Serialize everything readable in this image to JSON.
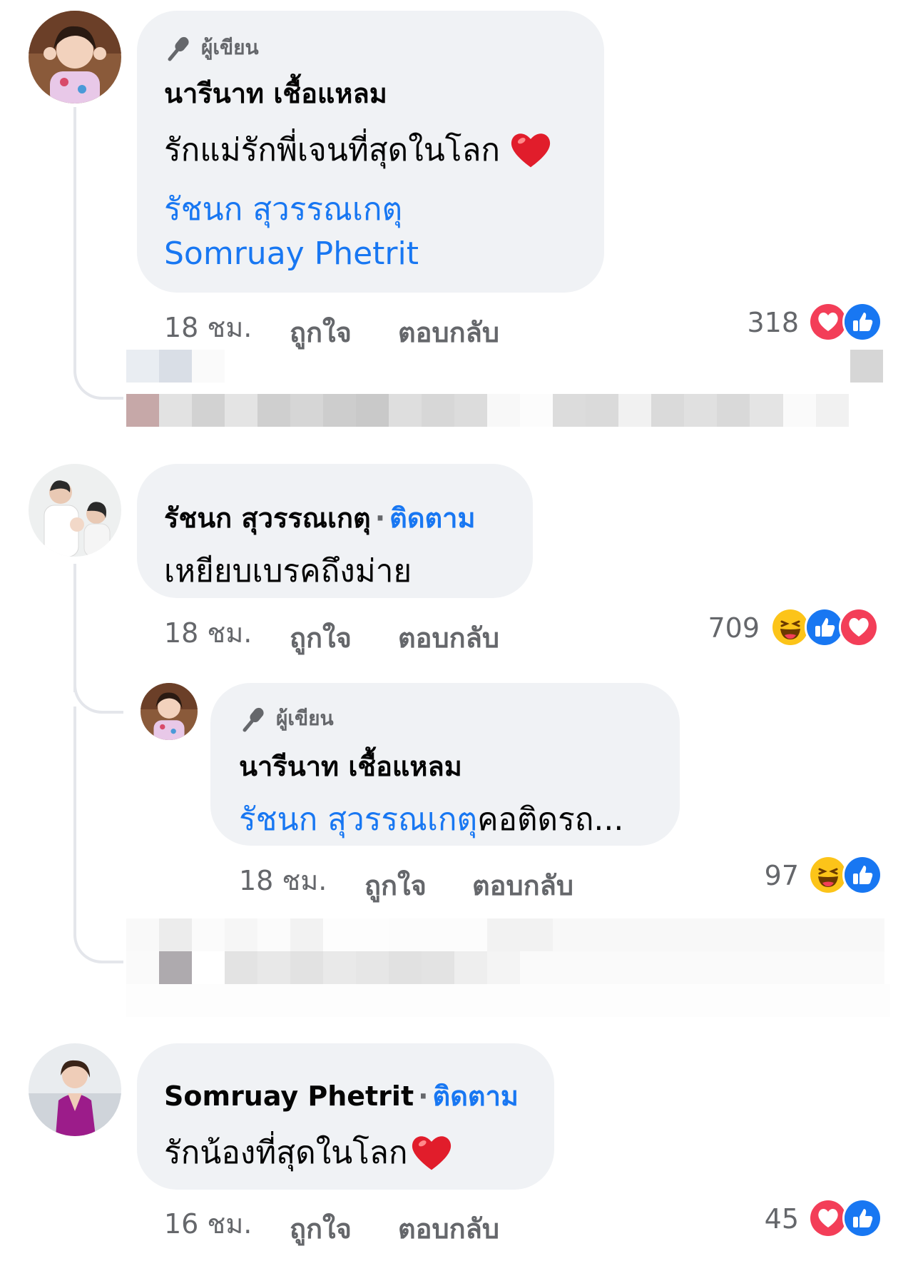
{
  "comments": [
    {
      "badge": "ผู้เขียน",
      "author": "นารีนาท เชื้อแหลม",
      "text": "รักแม่รักพี่เจนที่สุดในโลก",
      "mentions": [
        "รัชนก สุวรรณเกตุ",
        "Somruay Phetrit"
      ],
      "time": "18 ชม.",
      "like_label": "ถูกใจ",
      "reply_label": "ตอบกลับ",
      "reaction_count": "318",
      "reactions": [
        "love-icon",
        "like-icon"
      ]
    },
    {
      "author": "รัชนก สุวรรณเกตุ",
      "follow_label": "ติดตาม",
      "text": "เหยียบเบรคถึงม่าย",
      "time": "18 ชม.",
      "like_label": "ถูกใจ",
      "reply_label": "ตอบกลับ",
      "reaction_count": "709",
      "reactions": [
        "haha-icon",
        "like-icon",
        "love-icon"
      ],
      "reply": {
        "badge": "ผู้เขียน",
        "author": "นารีนาท เชื้อแหลม",
        "mention": "รัชนก สุวรรณเกตุ",
        "text": " คอติดรถ...",
        "time": "18 ชม.",
        "like_label": "ถูกใจ",
        "reply_label": "ตอบกลับ",
        "reaction_count": "97",
        "reactions": [
          "haha-icon",
          "like-icon"
        ]
      }
    },
    {
      "author": "Somruay Phetrit",
      "follow_label": "ติดตาม",
      "text": "รักน้องที่สุดในโลก",
      "time": "16 ชม.",
      "like_label": "ถูกใจ",
      "reply_label": "ตอบกลับ",
      "reaction_count": "45",
      "reactions": [
        "love-icon",
        "like-icon"
      ]
    }
  ],
  "colors": {
    "bubble": "#f0f2f5",
    "link": "#1877f2",
    "meta": "#65676b",
    "love": "#f33e58",
    "like": "#1877f2",
    "haha": "#fcc419"
  }
}
